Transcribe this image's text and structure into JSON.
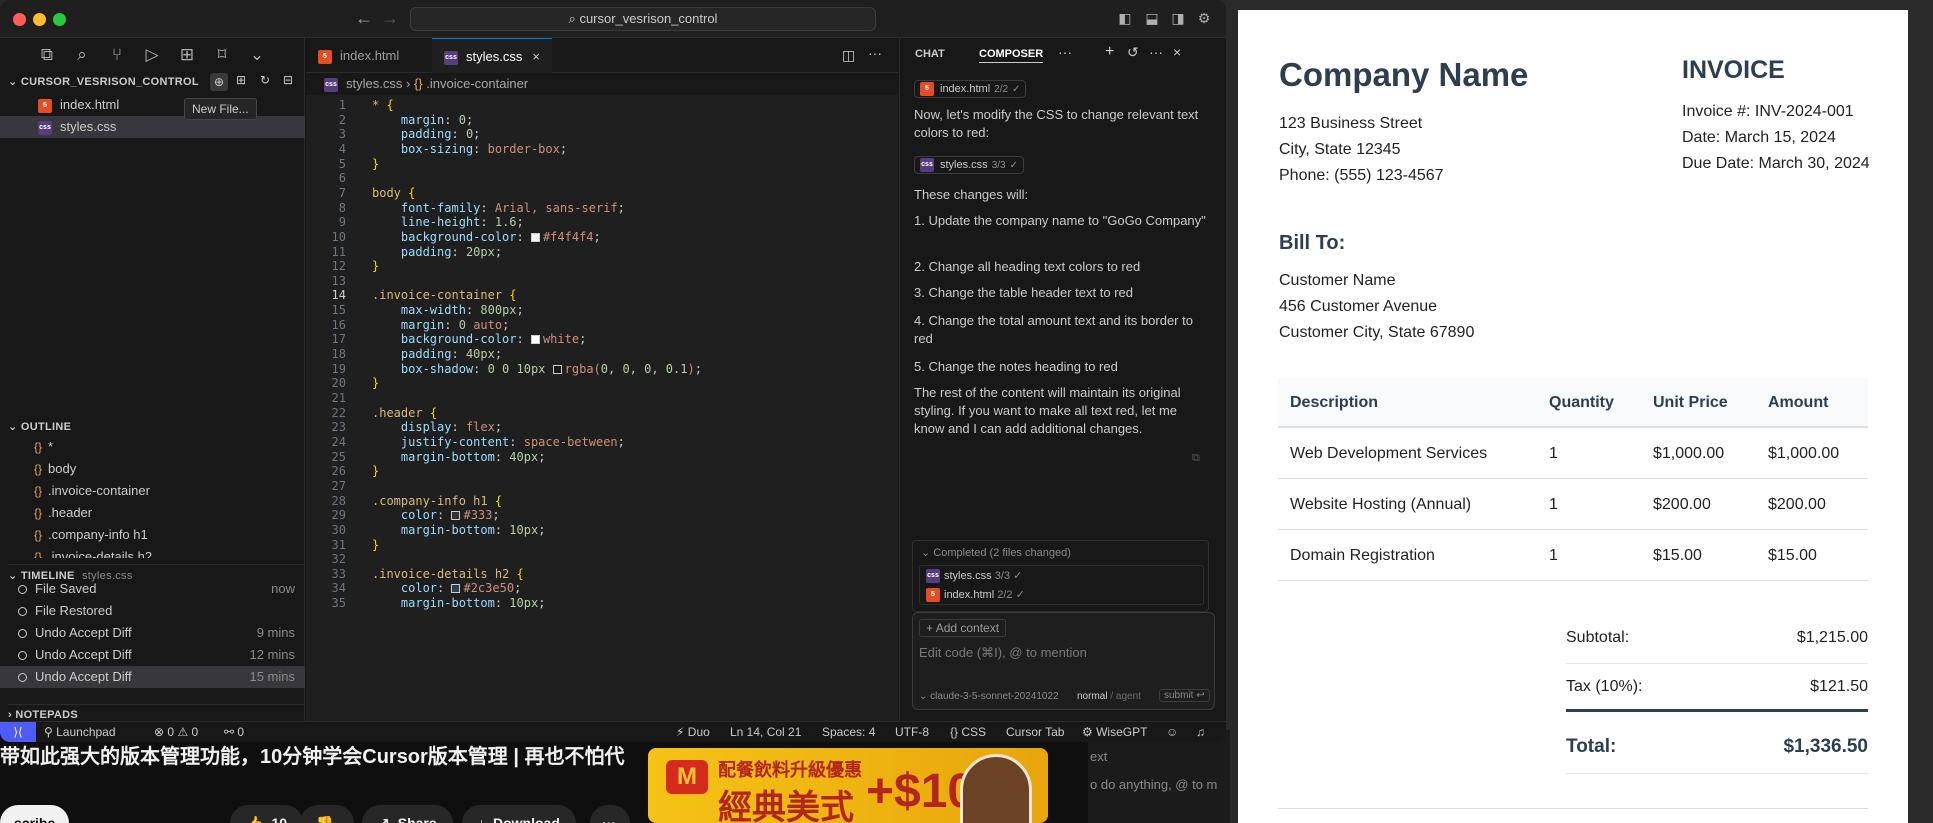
{
  "background": {
    "video_title": "带如此强大的版本管理功能，10分钟学会Cursor版本管理 | 再也不怕代",
    "subscribe_label": "scribe",
    "like_count": "10",
    "share_label": "Share",
    "download_label": "Download",
    "ad_line1": "配餐飲料升級優惠",
    "ad_line2": "經典美式",
    "ad_price": "+$10",
    "ad_logo": "M",
    "side_text1": "ext",
    "side_text2": "o do anything, @ to m"
  },
  "titlebar": {
    "search_text": "cursor_vesrison_control"
  },
  "explorer": {
    "project_name": "CURSOR_VESRISON_CONTROL",
    "files": [
      {
        "name": "index.html",
        "type": "html",
        "icon": "5"
      },
      {
        "name": "styles.css",
        "type": "css",
        "icon": "css"
      }
    ],
    "tooltip": "New File..."
  },
  "outline": {
    "header": "OUTLINE",
    "items": [
      "*",
      "body",
      ".invoice-container",
      ".header",
      ".company-info h1",
      ".invoice-details h2"
    ]
  },
  "timeline": {
    "header": "TIMELINE",
    "file": "styles.css",
    "items": [
      {
        "label": "File Saved",
        "time": "now"
      },
      {
        "label": "File Restored",
        "time": ""
      },
      {
        "label": "Undo Accept Diff",
        "time": "9 mins"
      },
      {
        "label": "Undo Accept Diff",
        "time": "12 mins"
      },
      {
        "label": "Undo Accept Diff",
        "time": "15 mins"
      }
    ]
  },
  "notepads": {
    "header": "NOTEPADS"
  },
  "editor": {
    "tabs": [
      {
        "label": "index.html",
        "active": false
      },
      {
        "label": "styles.css",
        "active": true
      }
    ],
    "breadcrumb_file": "styles.css",
    "breadcrumb_symbol": ".invoice-container",
    "current_line": 14
  },
  "chat": {
    "tab_chat": "CHAT",
    "tab_composer": "COMPOSER",
    "ref1_file": "index.html",
    "ref1_count": "2/2",
    "intro": "Now, let's modify the CSS to change relevant text colors to red:",
    "ref2_file": "styles.css",
    "ref2_count": "3/3",
    "changes_intro": "These changes will:",
    "changes": [
      "1. Update the company name to \"GoGo Company\"",
      "2. Change all heading text colors to red",
      "3. Change the table header text to red",
      "4. Change the total amount text and its border to red",
      "5. Change the notes heading to red"
    ],
    "outro": "The rest of the content will maintain its original styling. If you want to make all text red, let me know and I can add additional changes.",
    "completed": "Completed (2 files changed)",
    "completed_files": [
      {
        "name": "styles.css",
        "count": "3/3"
      },
      {
        "name": "index.html",
        "count": "2/2"
      }
    ],
    "add_context": "Add context",
    "placeholder": "Edit code (⌘I), @ to mention",
    "model": "claude-3-5-sonnet-20241022",
    "mode_normal": "normal",
    "mode_agent": "agent",
    "submit": "submit"
  },
  "statusbar": {
    "launchpad": "Launchpad",
    "errors": "0",
    "warnings": "0",
    "ports": "0",
    "duo": "Duo",
    "position": "Ln 14, Col 21",
    "spaces": "Spaces: 4",
    "encoding": "UTF-8",
    "language": "CSS",
    "cursor_tab": "Cursor Tab",
    "wisegpt": "WiseGPT"
  },
  "invoice": {
    "company_name": "Company Name",
    "address1": "123 Business Street",
    "address2": "City, State 12345",
    "phone": "Phone: (555) 123-4567",
    "title": "INVOICE",
    "number": "Invoice #: INV-2024-001",
    "date": "Date: March 15, 2024",
    "due": "Due Date: March 30, 2024",
    "bill_to": "Bill To:",
    "customer_name": "Customer Name",
    "customer_addr1": "456 Customer Avenue",
    "customer_addr2": "Customer City, State 67890",
    "headers": [
      "Description",
      "Quantity",
      "Unit Price",
      "Amount"
    ],
    "rows": [
      [
        "Web Development Services",
        "1",
        "$1,000.00",
        "$1,000.00"
      ],
      [
        "Website Hosting (Annual)",
        "1",
        "$200.00",
        "$200.00"
      ],
      [
        "Domain Registration",
        "1",
        "$15.00",
        "$15.00"
      ]
    ],
    "subtotal_label": "Subtotal:",
    "subtotal": "$1,215.00",
    "tax_label": "Tax (10%):",
    "tax": "$121.50",
    "total_label": "Total:",
    "total": "$1,336.50"
  },
  "colors": {
    "accent": "#0078d4",
    "heading": "#2c3e50",
    "statusbar_remote": "#4f5bf5"
  }
}
